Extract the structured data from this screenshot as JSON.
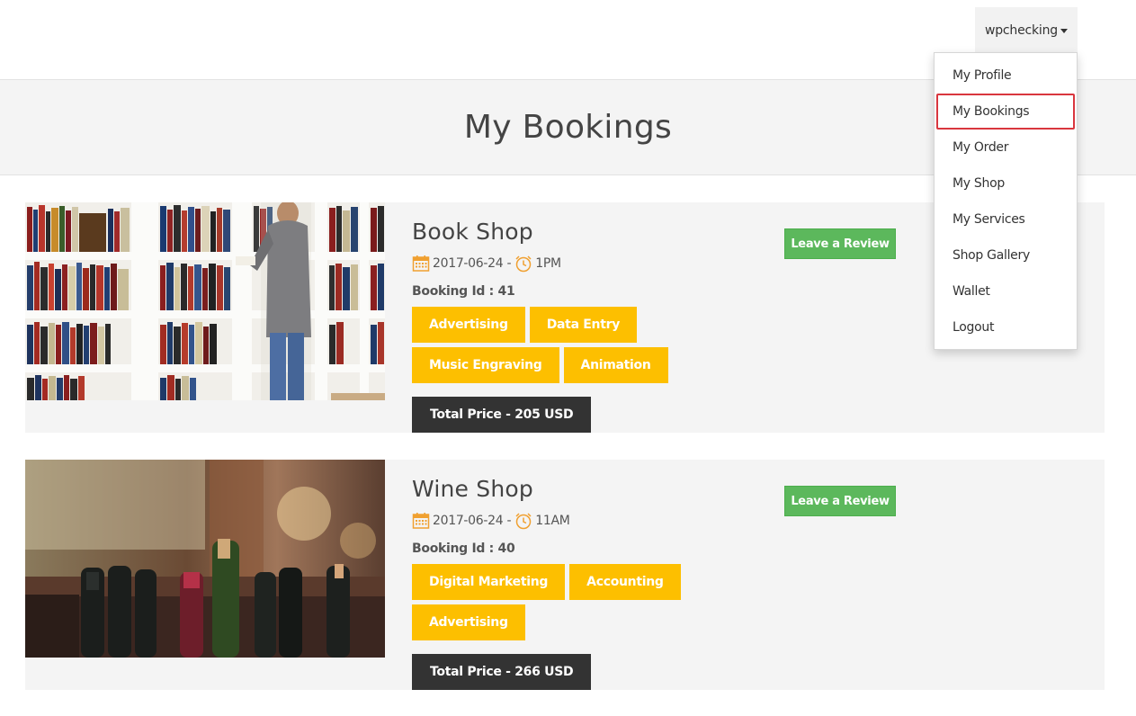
{
  "header": {
    "username": "wpchecking"
  },
  "user_menu": {
    "items": [
      {
        "label": "My Profile"
      },
      {
        "label": "My Bookings",
        "active": true
      },
      {
        "label": "My Order"
      },
      {
        "label": "My Shop"
      },
      {
        "label": "My Services"
      },
      {
        "label": "Shop Gallery"
      },
      {
        "label": "Wallet"
      },
      {
        "label": "Logout"
      }
    ]
  },
  "page": {
    "title": "My Bookings"
  },
  "bookings": [
    {
      "title": "Book Shop",
      "date": "2017-06-24 -",
      "time": "1PM",
      "booking_id": "Booking Id : 41",
      "services": [
        "Advertising",
        "Data Entry",
        "Music Engraving",
        "Animation"
      ],
      "total": "Total Price - 205 USD",
      "review_label": "Leave a Review"
    },
    {
      "title": "Wine Shop",
      "date": "2017-06-24 -",
      "time": "11AM",
      "booking_id": "Booking Id : 40",
      "services": [
        "Digital Marketing",
        "Accounting",
        "Advertising"
      ],
      "total": "Total Price - 266 USD",
      "review_label": "Leave a Review"
    }
  ],
  "colors": {
    "tag": "#fdbf00",
    "review_button": "#5cb85c",
    "total_bg": "#333333",
    "active_outline": "#d9363e",
    "icon_orange": "#f0a030"
  },
  "icons": {
    "calendar": "calendar-icon",
    "clock": "alarm-clock-icon",
    "caret": "caret-down-icon"
  }
}
